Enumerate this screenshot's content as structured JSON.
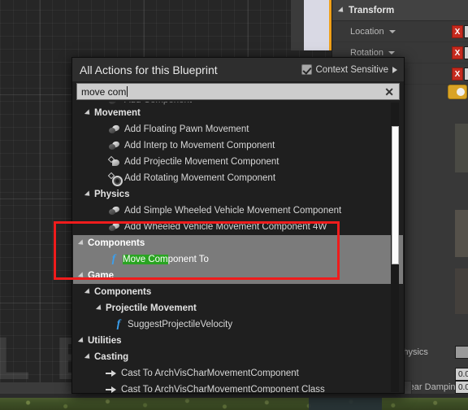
{
  "graph": {
    "watermark": "L B"
  },
  "details_panel": {
    "section_title": "Transform",
    "rows": [
      {
        "label": "Location",
        "has_dropdown": true,
        "axis": "X"
      },
      {
        "label": "Rotation",
        "has_dropdown": true,
        "axis": "X"
      },
      {
        "label": "",
        "has_dropdown": false,
        "axis": "X"
      }
    ],
    "physics_section": "Physics",
    "linear_damping_label": "Linear Damping",
    "linear_damping_value": "0.0",
    "angular_damping_value": "0.0",
    "axis_color": "#c52a1e",
    "accent_color": "#f0a019"
  },
  "action_menu": {
    "title": "All Actions for this Blueprint",
    "context_sensitive_label": "Context Sensitive",
    "context_sensitive_checked": true,
    "search": {
      "value": "move com",
      "clear_label": "✕"
    },
    "rows": [
      {
        "text": "Add Component",
        "type": "item",
        "icon": "component-icon",
        "indent": 44,
        "clipped": true,
        "selected": false
      },
      {
        "text": "Movement",
        "type": "category",
        "indent": 16,
        "selected": false
      },
      {
        "text": "Add Floating Pawn Movement",
        "type": "item",
        "icon": "component-icon",
        "indent": 44,
        "selected": false
      },
      {
        "text": "Add Interp to Movement Component",
        "type": "item",
        "icon": "component-icon",
        "indent": 44,
        "selected": false
      },
      {
        "text": "Add Projectile Movement Component",
        "type": "item",
        "icon": "projectile-icon",
        "indent": 44,
        "selected": false
      },
      {
        "text": "Add Rotating Movement Component",
        "type": "item",
        "icon": "rotating-icon",
        "indent": 44,
        "selected": false
      },
      {
        "text": "Physics",
        "type": "category",
        "indent": 16,
        "selected": false
      },
      {
        "text": "Add Simple Wheeled Vehicle Movement Component",
        "type": "item",
        "icon": "component-icon",
        "indent": 44,
        "selected": false
      },
      {
        "text": "Add Wheeled Vehicle Movement Component 4W",
        "type": "item",
        "icon": "component-icon",
        "indent": 44,
        "selected": false
      },
      {
        "text": "Components",
        "type": "category",
        "indent": 8,
        "selected": true
      },
      {
        "text": "Move Component To",
        "type": "item",
        "icon": "function-icon",
        "indent": 44,
        "selected": true,
        "highlight": "Move Com"
      },
      {
        "text": "Game",
        "type": "category",
        "indent": 8,
        "selected": true
      },
      {
        "text": "Components",
        "type": "category",
        "indent": 16,
        "selected": false
      },
      {
        "text": "Projectile Movement",
        "type": "category",
        "indent": 30,
        "selected": false
      },
      {
        "text": "SuggestProjectileVelocity",
        "type": "item",
        "icon": "function-icon",
        "indent": 50,
        "selected": false
      },
      {
        "text": "Utilities",
        "type": "category",
        "indent": 8,
        "selected": false
      },
      {
        "text": "Casting",
        "type": "category",
        "indent": 16,
        "selected": false
      },
      {
        "text": "Cast To ArchVisCharMovementComponent",
        "type": "item",
        "icon": "cast-icon",
        "indent": 40,
        "selected": false
      },
      {
        "text": "Cast To ArchVisCharMovementComponent Class",
        "type": "item",
        "icon": "cast-icon",
        "indent": 40,
        "selected": false
      }
    ],
    "highlight_box_color": "#ef1c1c",
    "selection_color": "#7b7b7b",
    "match_highlight_color": "#2aa422"
  }
}
